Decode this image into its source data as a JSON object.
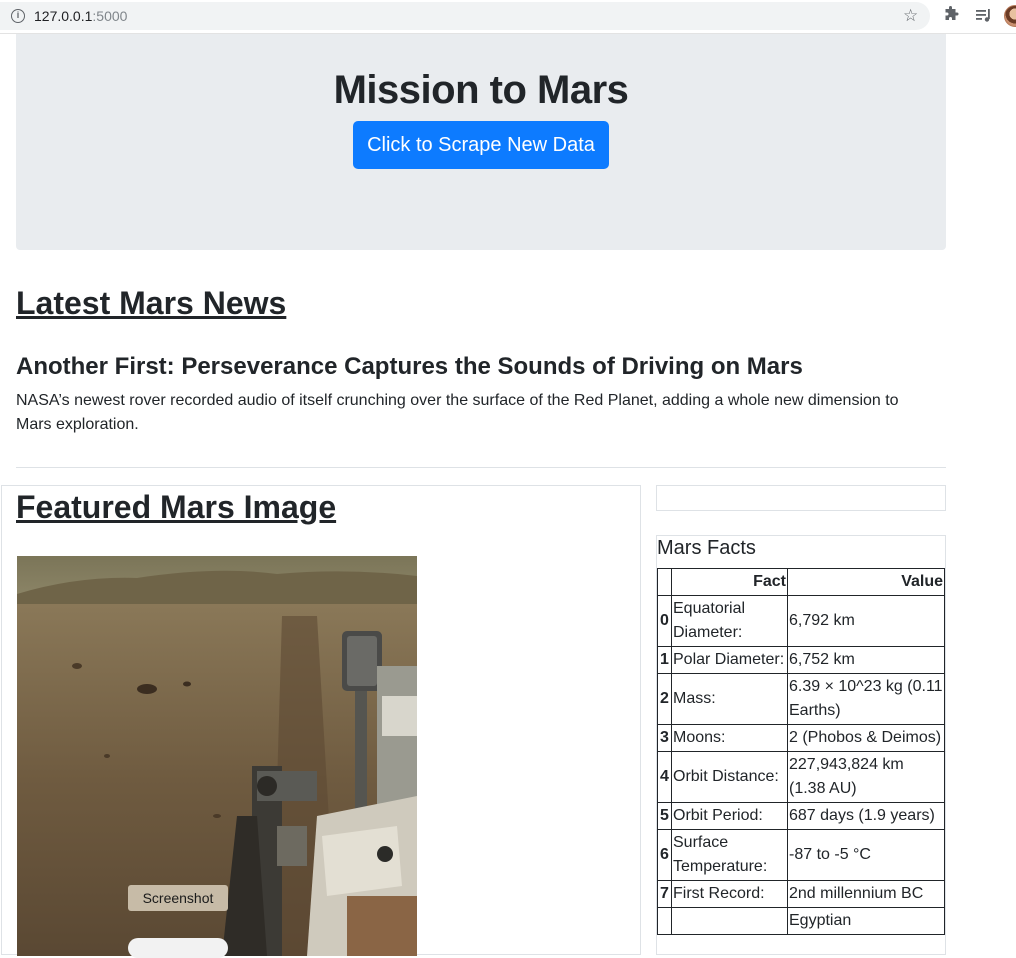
{
  "browser": {
    "url_host": "127.0.0.1",
    "url_port": ":5000",
    "icons": [
      "info-icon",
      "star-icon",
      "puzzle-icon",
      "media-icon",
      "avatar"
    ]
  },
  "jumbotron": {
    "title": "Mission to Mars",
    "button_label": "Click to Scrape New Data",
    "button_color": "#0d7bff",
    "background": "#e9ecef"
  },
  "news": {
    "heading": "Latest Mars News",
    "title": "Another First: Perseverance Captures the Sounds of Driving on Mars",
    "paragraph": "NASA’s newest rover recorded audio of itself crunching over the surface of the Red Planet, adding a whole new dimension to Mars exploration."
  },
  "featured_image": {
    "heading": "Featured Mars Image"
  },
  "facts": {
    "caption": "Mars Facts",
    "headers": [
      "",
      "Fact",
      "Value"
    ],
    "rows": [
      {
        "idx": "0",
        "fact": "Equatorial Diameter:",
        "value": "6,792 km"
      },
      {
        "idx": "1",
        "fact": "Polar Diameter:",
        "value": "6,752 km"
      },
      {
        "idx": "2",
        "fact": "Mass:",
        "value": "6.39 × 10^23 kg (0.11 Earths)"
      },
      {
        "idx": "3",
        "fact": "Moons:",
        "value": "2 (Phobos & Deimos)"
      },
      {
        "idx": "4",
        "fact": "Orbit Distance:",
        "value": "227,943,824 km (1.38 AU)"
      },
      {
        "idx": "5",
        "fact": "Orbit Period:",
        "value": "687 days (1.9 years)"
      },
      {
        "idx": "6",
        "fact": "Surface Temperature:",
        "value": "-87 to -5 °C"
      },
      {
        "idx": "7",
        "fact": "First Record:",
        "value": "2nd millennium BC"
      },
      {
        "idx": "",
        "fact": "",
        "value": "Egyptian"
      }
    ]
  },
  "overlay": {
    "screenshot_label": "Screenshot"
  }
}
